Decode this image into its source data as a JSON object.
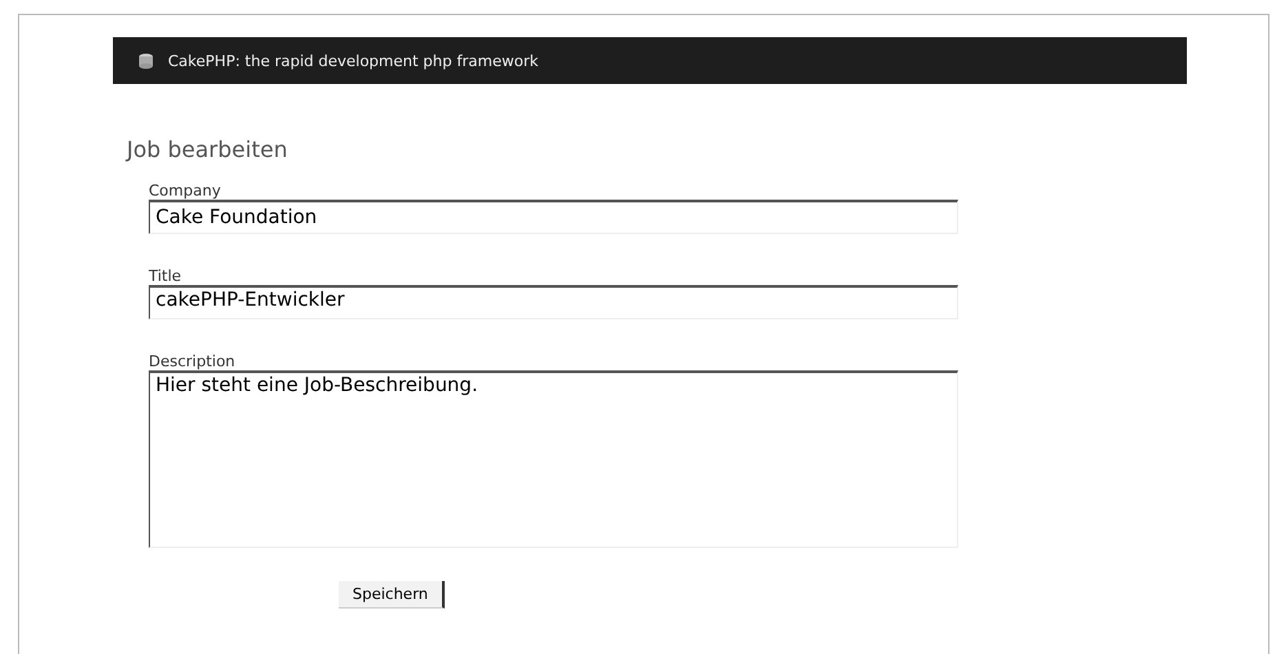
{
  "header": {
    "title": "CakePHP: the rapid development php framework"
  },
  "heading": "Job bearbeiten",
  "fields": [
    {
      "kind": "input",
      "label": "Company",
      "value": "Cake Foundation"
    },
    {
      "kind": "textarea_short",
      "label": "Title",
      "value": "cakePHP-Entwickler"
    },
    {
      "kind": "textarea",
      "label": "Description",
      "value": "Hier steht eine Job-Beschreibung."
    }
  ],
  "submit": "Speichern"
}
